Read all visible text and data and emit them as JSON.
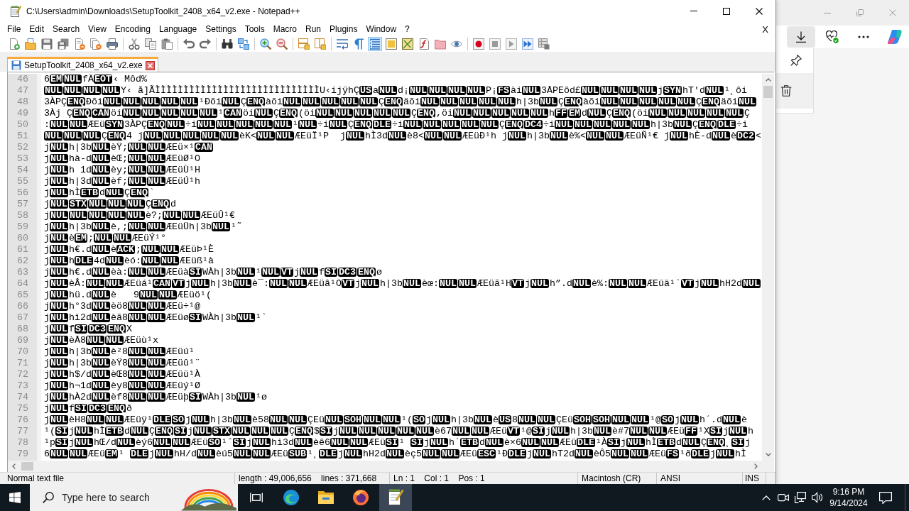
{
  "window": {
    "title": "C:\\Users\\admin\\Downloads\\SetupToolkit_2408_x64_v2.exe - Notepad++"
  },
  "menu": {
    "items": [
      "File",
      "Edit",
      "Search",
      "View",
      "Encoding",
      "Language",
      "Settings",
      "Tools",
      "Macro",
      "Run",
      "Plugins",
      "Window",
      "?"
    ],
    "close": "X"
  },
  "toolbar": {
    "groups": [
      {
        "buttons": [
          {
            "on": false
          },
          {
            "on": false
          },
          {
            "on": false
          },
          {
            "on": false
          },
          {
            "on": false
          },
          {
            "on": false
          },
          {
            "on": false
          }
        ]
      },
      {
        "buttons": [
          {
            "on": false
          },
          {
            "on": false
          },
          {
            "on": false
          }
        ]
      },
      {
        "buttons": [
          {
            "on": false
          },
          {
            "on": false
          }
        ]
      },
      {
        "buttons": [
          {
            "on": false
          },
          {
            "on": false
          }
        ]
      },
      {
        "buttons": [
          {
            "on": false
          },
          {
            "on": false
          }
        ]
      },
      {
        "buttons": [
          {
            "on": false
          },
          {
            "on": false
          }
        ]
      },
      {
        "buttons": [
          {
            "on": false
          },
          {
            "on": false
          },
          {
            "on": true
          },
          {
            "on": false
          },
          {
            "on": false
          },
          {
            "on": false
          },
          {
            "on": false
          },
          {
            "on": false
          }
        ]
      },
      {
        "buttons": [
          {
            "on": false
          },
          {
            "on": false
          },
          {
            "on": false
          },
          {
            "on": false
          },
          {
            "on": false
          }
        ]
      }
    ]
  },
  "tabs": [
    {
      "label": "SetupToolkit_2408_x64_v2.exe",
      "selected": true,
      "modified": false
    }
  ],
  "editor": {
    "lines": [
      {
        "number": "46",
        "runs": [
          {
            "text": "6",
            "controls": [
              "EM",
              "NUL"
            ]
          },
          {
            "text": "fÄ",
            "controls": [
              "EOT"
            ]
          },
          {
            "text": "‹ Môd%"
          }
        ]
      },
      {
        "number": "47",
        "runs": [
          {
            "controls": [
              "NUL",
              "NUL",
              "NUL",
              "NUL"
            ]
          },
          {
            "text": "Y‹ å]ÃÌÌÌÌÌÌÌÌÌÌÌÌÌÌÌÌÌÌÌÌÌÌÌÌÌÌÌÌÌU‹ijÿhÇ",
            "controls": [
              "US"
            ]
          },
          {
            "text": "a",
            "controls": [
              "NUL"
            ]
          },
          {
            "text": "d¡",
            "controls": [
              "NUL",
              "NUL",
              "NUL",
              "NUL"
            ]
          },
          {
            "text": "P¡",
            "controls": [
              "FS"
            ]
          },
          {
            "text": "ài",
            "controls": [
              "NUL"
            ]
          },
          {
            "text": "3ÅPEôd£",
            "controls": [
              "NUL",
              "NUL",
              "NUL",
              "NUL"
            ]
          },
          {
            "text": "j",
            "controls": [
              "SYN"
            ]
          },
          {
            "text": "hT'd",
            "controls": [
              "NUL"
            ]
          },
          {
            "text": "¹¸ôi"
          }
        ]
      },
      {
        "number": "48",
        "runs": [
          {
            "text": "3ÀPÇ",
            "controls": [
              "ENQ"
            ]
          },
          {
            "text": "Ðõi",
            "controls": [
              "NUL",
              "NUL",
              "NUL",
              "NUL",
              "NUL"
            ]
          },
          {
            "text": "¹Ðõi",
            "controls": [
              "NUL"
            ]
          },
          {
            "text": "Ç",
            "controls": [
              "ENQ"
            ]
          },
          {
            "text": "àõi",
            "controls": [
              "NUL",
              "NUL",
              "NUL",
              "NUL",
              "NUL"
            ]
          },
          {
            "text": "Ç",
            "controls": [
              "ENQ"
            ]
          },
          {
            "text": "äõi",
            "controls": [
              "NUL",
              "NUL",
              "NUL",
              "NUL",
              "NUL"
            ]
          },
          {
            "text": "h|3b",
            "controls": [
              "NUL"
            ]
          },
          {
            "text": "Ç",
            "controls": [
              "ENQ"
            ]
          },
          {
            "text": "àõi",
            "controls": [
              "NUL",
              "NUL",
              "NUL",
              "NUL",
              "NUL"
            ]
          },
          {
            "text": "Ç",
            "controls": [
              "ENQ"
            ]
          },
          {
            "text": "äõi",
            "controls": [
              "NUL"
            ]
          }
        ]
      },
      {
        "number": "49",
        "runs": [
          {
            "text": "3Àj Ç",
            "controls": [
              "ENQ",
              "CAN"
            ]
          },
          {
            "text": "öi",
            "controls": [
              "NUL",
              "NUL",
              "NUL",
              "NUL",
              "NUL"
            ]
          },
          {
            "text": "¹",
            "controls": [
              "CAN"
            ]
          },
          {
            "text": "öi",
            "controls": [
              "NUL"
            ]
          },
          {
            "text": "Ç",
            "controls": [
              "ENQ"
            ]
          },
          {
            "text": "(öi",
            "controls": [
              "NUL",
              "NUL",
              "NUL",
              "NUL",
              "NUL"
            ]
          },
          {
            "text": "Ç",
            "controls": [
              "ENQ"
            ]
          },
          {
            "text": ",öi",
            "controls": [
              "NUL",
              "NUL",
              "NUL",
              "NUL",
              "NUL"
            ]
          },
          {
            "text": "h",
            "controls": [
              "FF",
              "EM"
            ]
          },
          {
            "text": "d",
            "controls": [
              "NUL"
            ]
          },
          {
            "text": "Ç",
            "controls": [
              "ENQ"
            ]
          },
          {
            "text": "(öi",
            "controls": [
              "NUL",
              "NUL",
              "NUL",
              "NUL",
              "NUL"
            ]
          },
          {
            "text": "Ç"
          }
        ]
      },
      {
        "number": "50",
        "runs": [
          {
            "text": ":",
            "controls": [
              "NUL",
              "NUL"
            ]
          },
          {
            "text": "ÆEü",
            "controls": [
              "SYN"
            ]
          },
          {
            "text": "3ÀPÇ",
            "controls": [
              "ENQ",
              "NUL"
            ]
          },
          {
            "text": "÷i",
            "controls": [
              "NUL",
              "NUL",
              "NUL",
              "NUL",
              "NUL"
            ]
          },
          {
            "text": "¹",
            "controls": [
              "NUL"
            ]
          },
          {
            "text": "÷i",
            "controls": [
              "NUL"
            ]
          },
          {
            "text": "Ç",
            "controls": [
              "ENQ",
              "DLE"
            ]
          },
          {
            "text": "÷i",
            "controls": [
              "NUL",
              "NUL",
              "NUL",
              "NUL",
              "NUL"
            ]
          },
          {
            "text": "Ç",
            "controls": [
              "ENQ",
              "DC4"
            ]
          },
          {
            "text": "÷i",
            "controls": [
              "NUL",
              "NUL",
              "NUL",
              "NUL",
              "NUL"
            ]
          },
          {
            "text": "h|3b",
            "controls": [
              "NUL"
            ]
          },
          {
            "text": "Ç",
            "controls": [
              "ENQ",
              "DLE"
            ]
          },
          {
            "text": "÷i"
          }
        ]
      },
      {
        "number": "51",
        "runs": [
          {
            "controls": [
              "NUL",
              "NUL",
              "NUL"
            ]
          },
          {
            "text": "Ç",
            "controls": [
              "ENQ"
            ]
          },
          {
            "text": "4 j",
            "controls": [
              "NUL",
              "NUL",
              "NUL",
              "NUL",
              "NUL"
            ]
          },
          {
            "text": "èK<",
            "controls": [
              "NUL",
              "NUL"
            ]
          },
          {
            "text": "ÆEüÏ¹P  j",
            "controls": [
              "NUL"
            ]
          },
          {
            "text": "hÌ3d",
            "controls": [
              "NUL"
            ]
          },
          {
            "text": "è8<",
            "controls": [
              "NUL",
              "NUL"
            ]
          },
          {
            "text": "ÆEüÐ¹h j",
            "controls": [
              "NUL"
            ]
          },
          {
            "text": "h|3b",
            "controls": [
              "NUL"
            ]
          },
          {
            "text": "è%<",
            "controls": [
              "NUL",
              "NUL"
            ]
          },
          {
            "text": "ÆEüÑ¹€ j",
            "controls": [
              "NUL"
            ]
          },
          {
            "text": "hÈ-d",
            "controls": [
              "NUL"
            ]
          },
          {
            "text": "è",
            "controls": [
              "DC2"
            ]
          },
          {
            "text": "<"
          }
        ]
      },
      {
        "number": "52",
        "runs": [
          {
            "text": "j",
            "controls": [
              "NUL"
            ]
          },
          {
            "text": "h|3b",
            "controls": [
              "NUL"
            ]
          },
          {
            "text": "èŸ;",
            "controls": [
              "NUL",
              "NUL"
            ]
          },
          {
            "text": "ÆEü×¹",
            "controls": [
              "CAN"
            ]
          }
        ]
      },
      {
        "number": "53",
        "runs": [
          {
            "text": "j",
            "controls": [
              "NUL"
            ]
          },
          {
            "text": "hà-d",
            "controls": [
              "NUL"
            ]
          },
          {
            "text": "èŒ;",
            "controls": [
              "NUL",
              "NUL"
            ]
          },
          {
            "text": "ÆEüØ¹O"
          }
        ]
      },
      {
        "number": "54",
        "runs": [
          {
            "text": "j",
            "controls": [
              "NUL"
            ]
          },
          {
            "text": "h 1d",
            "controls": [
              "NUL"
            ]
          },
          {
            "text": "èy;",
            "controls": [
              "NUL",
              "NUL"
            ]
          },
          {
            "text": "ÆEüÙ¹H"
          }
        ]
      },
      {
        "number": "55",
        "runs": [
          {
            "text": "j",
            "controls": [
              "NUL"
            ]
          },
          {
            "text": "h|3d",
            "controls": [
              "NUL"
            ]
          },
          {
            "text": "èf;",
            "controls": [
              "NUL",
              "NUL"
            ]
          },
          {
            "text": "ÆEüÚ¹h"
          }
        ]
      },
      {
        "number": "56",
        "runs": [
          {
            "text": "j",
            "controls": [
              "NUL"
            ]
          },
          {
            "text": "hÌ",
            "controls": [
              "ETB"
            ]
          },
          {
            "text": "d",
            "controls": [
              "NUL"
            ]
          },
          {
            "text": "Ç",
            "controls": [
              "ENQ"
            ]
          },
          {
            "text": "`"
          }
        ]
      },
      {
        "number": "57",
        "runs": [
          {
            "text": "j",
            "controls": [
              "NUL",
              "STX",
              "NUL",
              "NUL",
              "NUL"
            ]
          },
          {
            "text": "Ç",
            "controls": [
              "ENQ"
            ]
          },
          {
            "text": "d"
          }
        ]
      },
      {
        "number": "58",
        "runs": [
          {
            "text": "j",
            "controls": [
              "NUL",
              "NUL",
              "NUL",
              "NUL",
              "NUL"
            ]
          },
          {
            "text": "è?;",
            "controls": [
              "NUL",
              "NUL"
            ]
          },
          {
            "text": "ÆEüÛ¹€"
          }
        ]
      },
      {
        "number": "59",
        "runs": [
          {
            "text": "j",
            "controls": [
              "NUL"
            ]
          },
          {
            "text": "h|3b",
            "controls": [
              "NUL"
            ]
          },
          {
            "text": "è,;",
            "controls": [
              "NUL",
              "NUL"
            ]
          },
          {
            "text": "ÆEüÜh|3b",
            "controls": [
              "NUL"
            ]
          },
          {
            "text": "¹˜"
          }
        ]
      },
      {
        "number": "60",
        "runs": [
          {
            "text": "j",
            "controls": [
              "NUL"
            ]
          },
          {
            "text": "è",
            "controls": [
              "EM"
            ]
          },
          {
            "text": ";",
            "controls": [
              "NUL",
              "NUL"
            ]
          },
          {
            "text": "ÆEüÝ¹°"
          }
        ]
      },
      {
        "number": "61",
        "runs": [
          {
            "text": "j",
            "controls": [
              "NUL"
            ]
          },
          {
            "text": "h€.d",
            "controls": [
              "NUL"
            ]
          },
          {
            "text": "è",
            "controls": [
              "ACK"
            ]
          },
          {
            "text": ";",
            "controls": [
              "NUL",
              "NUL"
            ]
          },
          {
            "text": "ÆEüÞ¹È"
          }
        ]
      },
      {
        "number": "62",
        "runs": [
          {
            "text": "j",
            "controls": [
              "NUL"
            ]
          },
          {
            "text": "h",
            "controls": [
              "DLE"
            ]
          },
          {
            "text": "4d",
            "controls": [
              "NUL"
            ]
          },
          {
            "text": "èó:",
            "controls": [
              "NUL",
              "NUL"
            ]
          },
          {
            "text": "ÆEüß¹à"
          }
        ]
      },
      {
        "number": "63",
        "runs": [
          {
            "text": "j",
            "controls": [
              "NUL"
            ]
          },
          {
            "text": "h€.d",
            "controls": [
              "NUL"
            ]
          },
          {
            "text": "èà:",
            "controls": [
              "NUL",
              "NUL"
            ]
          },
          {
            "text": "ÆEüà",
            "controls": [
              "SI"
            ]
          },
          {
            "text": "WÀh|3b",
            "controls": [
              "NUL"
            ]
          },
          {
            "text": "¹",
            "controls": [
              "NUL",
              "VT"
            ]
          },
          {
            "text": "j",
            "controls": [
              "NUL"
            ]
          },
          {
            "text": "f",
            "controls": [
              "SI",
              "DC3",
              "ENQ"
            ]
          },
          {
            "text": "ø"
          }
        ]
      },
      {
        "number": "64",
        "runs": [
          {
            "text": "j",
            "controls": [
              "NUL"
            ]
          },
          {
            "text": "èÂ:",
            "controls": [
              "NUL",
              "NUL"
            ]
          },
          {
            "text": "ÆEüá¹",
            "controls": [
              "CAN",
              "VT"
            ]
          },
          {
            "text": "j",
            "controls": [
              "NUL"
            ]
          },
          {
            "text": "h|3b",
            "controls": [
              "NUL"
            ]
          },
          {
            "text": "è¯:",
            "controls": [
              "NUL",
              "NUL"
            ]
          },
          {
            "text": "ÆEüâ¹O",
            "controls": [
              "VT"
            ]
          },
          {
            "text": "j",
            "controls": [
              "NUL"
            ]
          },
          {
            "text": "h|3b",
            "controls": [
              "NUL"
            ]
          },
          {
            "text": "èœ:",
            "controls": [
              "NUL",
              "NUL"
            ]
          },
          {
            "text": "ÆEüã¹H",
            "controls": [
              "VT"
            ]
          },
          {
            "text": "j",
            "controls": [
              "NUL"
            ]
          },
          {
            "text": "h”.d",
            "controls": [
              "NUL"
            ]
          },
          {
            "text": "è%:",
            "controls": [
              "NUL",
              "NUL"
            ]
          },
          {
            "text": "ÆEüä¹`",
            "controls": [
              "VT"
            ]
          },
          {
            "text": "j",
            "controls": [
              "NUL"
            ]
          },
          {
            "text": "hH2d",
            "controls": [
              "NUL"
            ]
          }
        ]
      },
      {
        "number": "65",
        "runs": [
          {
            "text": "j",
            "controls": [
              "NUL"
            ]
          },
          {
            "text": "hü.d",
            "controls": [
              "NUL"
            ]
          },
          {
            "text": "è   9",
            "controls": [
              "NUL",
              "NUL"
            ]
          },
          {
            "text": "ÆEüö¹("
          }
        ]
      },
      {
        "number": "66",
        "runs": [
          {
            "text": "j",
            "controls": [
              "NUL"
            ]
          },
          {
            "text": "h°3d",
            "controls": [
              "NUL"
            ]
          },
          {
            "text": "èö8",
            "controls": [
              "NUL",
              "NUL"
            ]
          },
          {
            "text": "ÆEü÷¹@"
          }
        ]
      },
      {
        "number": "67",
        "runs": [
          {
            "text": "j",
            "controls": [
              "NUL"
            ]
          },
          {
            "text": "hì2d",
            "controls": [
              "NUL"
            ]
          },
          {
            "text": "èã8",
            "controls": [
              "NUL",
              "NUL"
            ]
          },
          {
            "text": "ÆEüø",
            "controls": [
              "SI"
            ]
          },
          {
            "text": "WÀh|3b",
            "controls": [
              "NUL"
            ]
          },
          {
            "text": "¹`"
          }
        ]
      },
      {
        "number": "68",
        "runs": [
          {
            "text": "j",
            "controls": [
              "NUL"
            ]
          },
          {
            "text": "f",
            "controls": [
              "SI",
              "DC3",
              "ENQ"
            ]
          },
          {
            "text": "X"
          }
        ]
      },
      {
        "number": "69",
        "runs": [
          {
            "text": "j",
            "controls": [
              "NUL"
            ]
          },
          {
            "text": "èÅ8",
            "controls": [
              "NUL",
              "NUL"
            ]
          },
          {
            "text": "ÆEüù¹x"
          }
        ]
      },
      {
        "number": "70",
        "runs": [
          {
            "text": "j",
            "controls": [
              "NUL"
            ]
          },
          {
            "text": "h|3b",
            "controls": [
              "NUL"
            ]
          },
          {
            "text": "è²8",
            "controls": [
              "NUL",
              "NUL"
            ]
          },
          {
            "text": "ÆEüú¹"
          }
        ]
      },
      {
        "number": "71",
        "runs": [
          {
            "text": "j",
            "controls": [
              "NUL"
            ]
          },
          {
            "text": "h|3b",
            "controls": [
              "NUL"
            ]
          },
          {
            "text": "èŸ8",
            "controls": [
              "NUL",
              "NUL"
            ]
          },
          {
            "text": "ÆEüû¹¨"
          }
        ]
      },
      {
        "number": "72",
        "runs": [
          {
            "text": "j",
            "controls": [
              "NUL"
            ]
          },
          {
            "text": "h$/d",
            "controls": [
              "NUL"
            ]
          },
          {
            "text": "èŒ8",
            "controls": [
              "NUL",
              "NUL"
            ]
          },
          {
            "text": "ÆEüü¹À"
          }
        ]
      },
      {
        "number": "73",
        "runs": [
          {
            "text": "j",
            "controls": [
              "NUL"
            ]
          },
          {
            "text": "h¬1d",
            "controls": [
              "NUL"
            ]
          },
          {
            "text": "èy8",
            "controls": [
              "NUL",
              "NUL"
            ]
          },
          {
            "text": "ÆEüý¹Ø"
          }
        ]
      },
      {
        "number": "74",
        "runs": [
          {
            "text": "j",
            "controls": [
              "NUL"
            ]
          },
          {
            "text": "hÀ2d",
            "controls": [
              "NUL"
            ]
          },
          {
            "text": "èf8",
            "controls": [
              "NUL",
              "NUL"
            ]
          },
          {
            "text": "ÆEüþ",
            "controls": [
              "SI"
            ]
          },
          {
            "text": "WÀh|3b",
            "controls": [
              "NUL"
            ]
          },
          {
            "text": "¹ø"
          }
        ]
      },
      {
        "number": "75",
        "runs": [
          {
            "text": "j",
            "controls": [
              "NUL"
            ]
          },
          {
            "text": "f",
            "controls": [
              "SI",
              "DC3",
              "ENQ"
            ]
          },
          {
            "text": "ð"
          }
        ]
      },
      {
        "number": "76",
        "runs": [
          {
            "text": "j",
            "controls": [
              "NUL"
            ]
          },
          {
            "text": "èH8",
            "controls": [
              "NUL",
              "NUL"
            ]
          },
          {
            "text": "ÆEüÿ¹",
            "controls": [
              "DLE",
              "SO"
            ]
          },
          {
            "text": "j",
            "controls": [
              "NUL"
            ]
          },
          {
            "text": "h|3b",
            "controls": [
              "NUL"
            ]
          },
          {
            "text": "è58",
            "controls": [
              "NUL",
              "NUL"
            ]
          },
          {
            "text": "ÇEü",
            "controls": [
              "NUL",
              "SOH",
              "NUL",
              "NUL"
            ]
          },
          {
            "text": "¹(",
            "controls": [
              "SO"
            ]
          },
          {
            "text": "j",
            "controls": [
              "NUL"
            ]
          },
          {
            "text": "h|3b",
            "controls": [
              "NUL"
            ]
          },
          {
            "text": "è",
            "controls": [
              "US"
            ]
          },
          {
            "text": "8",
            "controls": [
              "NUL",
              "NUL"
            ]
          },
          {
            "text": "ÇEü",
            "controls": [
              "SOH",
              "SOH",
              "NUL",
              "NUL"
            ]
          },
          {
            "text": "¹@",
            "controls": [
              "SO"
            ]
          },
          {
            "text": "j",
            "controls": [
              "NUL"
            ]
          },
          {
            "text": "h´.d",
            "controls": [
              "NUL"
            ]
          },
          {
            "text": "è"
          }
        ]
      },
      {
        "number": "77",
        "runs": [
          {
            "text": "¹(",
            "controls": [
              "SI"
            ]
          },
          {
            "text": "j",
            "controls": [
              "NUL"
            ]
          },
          {
            "text": "hÌ",
            "controls": [
              "ETB"
            ]
          },
          {
            "text": "d",
            "controls": [
              "NUL"
            ]
          },
          {
            "text": "Ç",
            "controls": [
              "ENQ",
              "SI"
            ]
          },
          {
            "text": "j",
            "controls": [
              "NUL",
              "STX",
              "NUL",
              "NUL",
              "NUL"
            ]
          },
          {
            "text": "Ç",
            "controls": [
              "ENQ"
            ]
          },
          {
            "text": "$",
            "controls": [
              "SI"
            ]
          },
          {
            "text": "j",
            "controls": [
              "NUL",
              "NUL",
              "NUL",
              "NUL",
              "NUL"
            ]
          },
          {
            "text": "è67",
            "controls": [
              "NUL",
              "NUL"
            ]
          },
          {
            "text": "ÆEü",
            "controls": [
              "VT"
            ]
          },
          {
            "text": "¹@",
            "controls": [
              "SI"
            ]
          },
          {
            "text": "j",
            "controls": [
              "NUL"
            ]
          },
          {
            "text": "h|3b",
            "controls": [
              "NUL"
            ]
          },
          {
            "text": "è#7",
            "controls": [
              "NUL",
              "NUL"
            ]
          },
          {
            "text": "ÆEü",
            "controls": [
              "FF"
            ]
          },
          {
            "text": "¹X",
            "controls": [
              "SI"
            ]
          },
          {
            "text": "j",
            "controls": [
              "NUL"
            ]
          },
          {
            "text": "h"
          }
        ]
      },
      {
        "number": "78",
        "runs": [
          {
            "text": "¹p",
            "controls": [
              "SI"
            ]
          },
          {
            "text": "j",
            "controls": [
              "NUL"
            ]
          },
          {
            "text": "hŒ/d",
            "controls": [
              "NUL"
            ]
          },
          {
            "text": "èý6",
            "controls": [
              "NUL",
              "NUL"
            ]
          },
          {
            "text": "ÆEü",
            "controls": [
              "SO"
            ]
          },
          {
            "text": "¹ˆ",
            "controls": [
              "SI"
            ]
          },
          {
            "text": "j",
            "controls": [
              "NUL"
            ]
          },
          {
            "text": "hì3d",
            "controls": [
              "NUL"
            ]
          },
          {
            "text": "èê6",
            "controls": [
              "NUL",
              "NUL"
            ]
          },
          {
            "text": "ÆEü",
            "controls": [
              "SI"
            ]
          },
          {
            "text": "¹ ",
            "controls": [
              "SI"
            ]
          },
          {
            "text": "j",
            "controls": [
              "NUL"
            ]
          },
          {
            "text": "h´",
            "controls": [
              "ETB"
            ]
          },
          {
            "text": "d",
            "controls": [
              "NUL"
            ]
          },
          {
            "text": "è×6",
            "controls": [
              "NUL",
              "NUL"
            ]
          },
          {
            "text": "ÆEü",
            "controls": [
              "DLE"
            ]
          },
          {
            "text": "¹À",
            "controls": [
              "SI"
            ]
          },
          {
            "text": "j",
            "controls": [
              "NUL"
            ]
          },
          {
            "text": "hÌ",
            "controls": [
              "ETB"
            ]
          },
          {
            "text": "d",
            "controls": [
              "NUL"
            ]
          },
          {
            "text": "Ç",
            "controls": [
              "ENQ"
            ]
          },
          {
            "text": "¸",
            "controls": [
              "SI"
            ]
          },
          {
            "text": "j"
          }
        ]
      },
      {
        "number": "79",
        "runs": [
          {
            "text": "6",
            "controls": [
              "NUL",
              "NUL"
            ]
          },
          {
            "text": "ÆEü",
            "controls": [
              "EM"
            ]
          },
          {
            "text": "¹ ",
            "controls": [
              "DLE"
            ]
          },
          {
            "text": "j",
            "controls": [
              "NUL"
            ]
          },
          {
            "text": "hH/d",
            "controls": [
              "NUL"
            ]
          },
          {
            "text": "èú5",
            "controls": [
              "NUL",
              "NUL"
            ]
          },
          {
            "text": "ÆEü",
            "controls": [
              "SUB"
            ]
          },
          {
            "text": "¹¸",
            "controls": [
              "DLE"
            ]
          },
          {
            "text": "j",
            "controls": [
              "NUL"
            ]
          },
          {
            "text": "hH2d",
            "controls": [
              "NUL"
            ]
          },
          {
            "text": "èç5",
            "controls": [
              "NUL",
              "NUL"
            ]
          },
          {
            "text": "ÆEü",
            "controls": [
              "ESC"
            ]
          },
          {
            "text": "¹Ð",
            "controls": [
              "DLE"
            ]
          },
          {
            "text": "j",
            "controls": [
              "NUL"
            ]
          },
          {
            "text": "hT2d",
            "controls": [
              "NUL"
            ]
          },
          {
            "text": "èÔ5",
            "controls": [
              "NUL",
              "NUL"
            ]
          },
          {
            "text": "ÆEü",
            "controls": [
              "FS"
            ]
          },
          {
            "text": "¹ð",
            "controls": [
              "DLE"
            ]
          },
          {
            "text": "j",
            "controls": [
              "NUL"
            ]
          },
          {
            "text": "hÌ"
          }
        ]
      }
    ]
  },
  "status_bar": [
    "Normal text file",
    "length : 49,006,656    lines : 371,668",
    "Ln : 1    Col : 1    Pos : 1",
    "Macintosh (CR)",
    "ANSI",
    "INS"
  ],
  "browser": {
    "toolbar": [
      {
        "selected": true
      },
      {
        "selected": false
      },
      {
        "selected": false
      },
      {
        "selected": false
      }
    ]
  },
  "taskbar": {
    "search": {
      "placeholder": "Type here to search"
    },
    "apps": [
      {
        "selected": false
      },
      {
        "selected": false
      },
      {
        "selected": false
      },
      {
        "selected": true
      }
    ],
    "clock": {
      "time": "9:16 PM",
      "date": "9/14/2024"
    }
  }
}
